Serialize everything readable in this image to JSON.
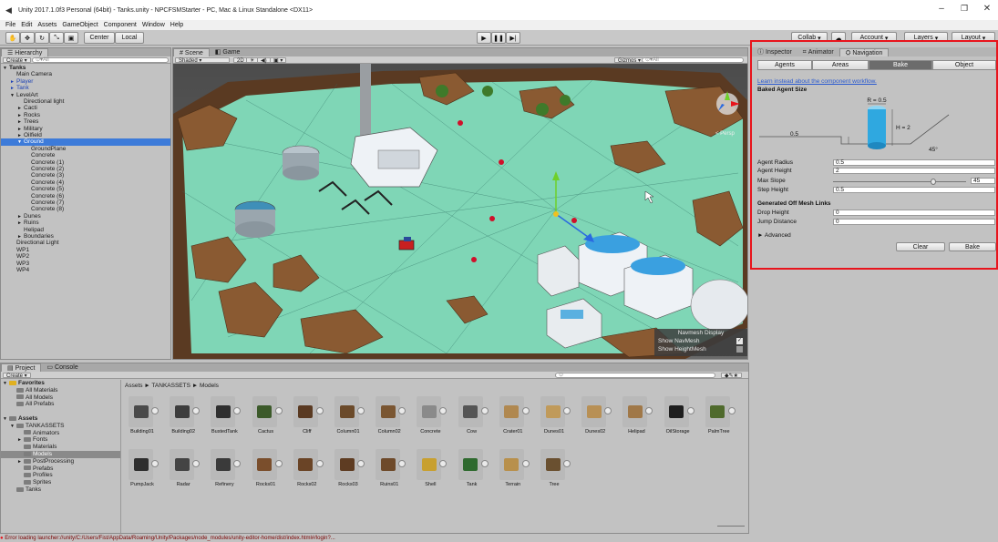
{
  "window": {
    "title": "Unity 2017.1.0f3 Personal (64bit) - Tanks.unity - NPCFSMStarter - PC, Mac & Linux Standalone <DX11>"
  },
  "menu": [
    "File",
    "Edit",
    "Assets",
    "GameObject",
    "Component",
    "Window",
    "Help"
  ],
  "toolbar": {
    "pivot": "Center",
    "space": "Local",
    "collab": "Collab",
    "account": "Account",
    "layers": "Layers",
    "layout": "Layout"
  },
  "hierarchy": {
    "tab": "Hierarchy",
    "create": "Create",
    "search": "All",
    "rows": [
      {
        "text": "Tanks",
        "indent": 0,
        "style": "bold",
        "arrow": "▼"
      },
      {
        "text": "Main Camera",
        "indent": 1,
        "style": "",
        "arrow": ""
      },
      {
        "text": "Player",
        "indent": 1,
        "style": "blue",
        "arrow": "►"
      },
      {
        "text": "Tank",
        "indent": 1,
        "style": "blue",
        "arrow": "►"
      },
      {
        "text": "LevelArt",
        "indent": 1,
        "style": "",
        "arrow": "▼"
      },
      {
        "text": "Directional light",
        "indent": 2,
        "style": "",
        "arrow": ""
      },
      {
        "text": "Cacti",
        "indent": 2,
        "style": "",
        "arrow": "►"
      },
      {
        "text": "Rocks",
        "indent": 2,
        "style": "",
        "arrow": "►"
      },
      {
        "text": "Trees",
        "indent": 2,
        "style": "",
        "arrow": "►"
      },
      {
        "text": "Military",
        "indent": 2,
        "style": "",
        "arrow": "►"
      },
      {
        "text": "Oilfield",
        "indent": 2,
        "style": "",
        "arrow": "►"
      },
      {
        "text": "Ground",
        "indent": 2,
        "style": "sel",
        "arrow": "▼"
      },
      {
        "text": "GroundPlane",
        "indent": 3,
        "style": "",
        "arrow": ""
      },
      {
        "text": "Concrete",
        "indent": 3,
        "style": "",
        "arrow": ""
      },
      {
        "text": "Concrete (1)",
        "indent": 3,
        "style": "",
        "arrow": ""
      },
      {
        "text": "Concrete (2)",
        "indent": 3,
        "style": "",
        "arrow": ""
      },
      {
        "text": "Concrete (3)",
        "indent": 3,
        "style": "",
        "arrow": ""
      },
      {
        "text": "Concrete (4)",
        "indent": 3,
        "style": "",
        "arrow": ""
      },
      {
        "text": "Concrete (5)",
        "indent": 3,
        "style": "",
        "arrow": ""
      },
      {
        "text": "Concrete (6)",
        "indent": 3,
        "style": "",
        "arrow": ""
      },
      {
        "text": "Concrete (7)",
        "indent": 3,
        "style": "",
        "arrow": ""
      },
      {
        "text": "Concrete (8)",
        "indent": 3,
        "style": "",
        "arrow": ""
      },
      {
        "text": "Dunes",
        "indent": 2,
        "style": "",
        "arrow": "►"
      },
      {
        "text": "Ruins",
        "indent": 2,
        "style": "",
        "arrow": "►"
      },
      {
        "text": "Helipad",
        "indent": 2,
        "style": "",
        "arrow": ""
      },
      {
        "text": "Boundaries",
        "indent": 2,
        "style": "",
        "arrow": "►"
      },
      {
        "text": "Directional Light",
        "indent": 1,
        "style": "",
        "arrow": ""
      },
      {
        "text": "WP1",
        "indent": 1,
        "style": "",
        "arrow": ""
      },
      {
        "text": "WP2",
        "indent": 1,
        "style": "",
        "arrow": ""
      },
      {
        "text": "WP3",
        "indent": 1,
        "style": "",
        "arrow": ""
      },
      {
        "text": "WP4",
        "indent": 1,
        "style": "",
        "arrow": ""
      }
    ]
  },
  "scene": {
    "tab_scene": "Scene",
    "tab_game": "Game",
    "shading": "Shaded",
    "mode_2d": "2D",
    "gizmos": "Gizmos",
    "search": "All",
    "persp": "< Persp",
    "navmesh_display": {
      "title": "Navmesh Display",
      "show_navmesh": "Show NavMesh",
      "show_heightmesh": "Show HeightMesh",
      "navmesh_checked": true,
      "heightmesh_checked": false
    }
  },
  "inspector": {
    "tabs": [
      "Inspector",
      "Animator",
      "Navigation"
    ],
    "active_tab": "Navigation",
    "nav_tabs": [
      "Agents",
      "Areas",
      "Bake",
      "Object"
    ],
    "active_nav_tab": "Bake",
    "link": "Learn instead about the component workflow.",
    "baked_title": "Baked Agent Size",
    "diagram": {
      "r": "R = 0.5",
      "h": "H = 2",
      "step": "0.5",
      "angle": "45°"
    },
    "fields": [
      {
        "label": "Agent Radius",
        "value": "0.5"
      },
      {
        "label": "Agent Height",
        "value": "2"
      },
      {
        "label": "Max Slope",
        "value": "45"
      },
      {
        "label": "Step Height",
        "value": "0.5"
      }
    ],
    "max_slope_fraction": 0.75,
    "offmesh_title": "Generated Off Mesh Links",
    "offmesh_fields": [
      {
        "label": "Drop Height",
        "value": "0"
      },
      {
        "label": "Jump Distance",
        "value": "0"
      }
    ],
    "advanced": "Advanced",
    "clear": "Clear",
    "bake": "Bake"
  },
  "project": {
    "tab_project": "Project",
    "tab_console": "Console",
    "create": "Create",
    "breadcrumb": "Assets ► TANKASSETS ► Models",
    "tree": [
      {
        "text": "Favorites",
        "indent": 0,
        "style": "bold",
        "arrow": "▼"
      },
      {
        "text": "All Materials",
        "indent": 1,
        "style": "",
        "arrow": ""
      },
      {
        "text": "All Models",
        "indent": 1,
        "style": "",
        "arrow": ""
      },
      {
        "text": "All Prefabs",
        "indent": 1,
        "style": "",
        "arrow": ""
      },
      {
        "text": "",
        "indent": 0,
        "style": "",
        "arrow": ""
      },
      {
        "text": "Assets",
        "indent": 0,
        "style": "bold",
        "arrow": "▼"
      },
      {
        "text": "TANKASSETS",
        "indent": 1,
        "style": "",
        "arrow": "▼"
      },
      {
        "text": "Animators",
        "indent": 2,
        "style": "",
        "arrow": ""
      },
      {
        "text": "Fonts",
        "indent": 2,
        "style": "",
        "arrow": "►"
      },
      {
        "text": "Materials",
        "indent": 2,
        "style": "",
        "arrow": ""
      },
      {
        "text": "Models",
        "indent": 2,
        "style": "sel",
        "arrow": ""
      },
      {
        "text": "PostProcessing",
        "indent": 2,
        "style": "",
        "arrow": "►"
      },
      {
        "text": "Prefabs",
        "indent": 2,
        "style": "",
        "arrow": ""
      },
      {
        "text": "Profiles",
        "indent": 2,
        "style": "",
        "arrow": ""
      },
      {
        "text": "Sprites",
        "indent": 2,
        "style": "",
        "arrow": ""
      },
      {
        "text": "Tanks",
        "indent": 1,
        "style": "",
        "arrow": ""
      }
    ],
    "assets": [
      {
        "name": "Building01",
        "color": "#4a4a4a"
      },
      {
        "name": "Building02",
        "color": "#3d3d3d"
      },
      {
        "name": "BustedTank",
        "color": "#2f2f2f"
      },
      {
        "name": "Cactus",
        "color": "#3c5a2a"
      },
      {
        "name": "Cliff",
        "color": "#5a3a22"
      },
      {
        "name": "Column01",
        "color": "#6b4a2a"
      },
      {
        "name": "Column02",
        "color": "#7a5632"
      },
      {
        "name": "Concrete",
        "color": "#8a8a8a"
      },
      {
        "name": "Cow",
        "color": "#555555"
      },
      {
        "name": "Crater01",
        "color": "#b08850"
      },
      {
        "name": "Dunes01",
        "color": "#c09a5a"
      },
      {
        "name": "Dunes02",
        "color": "#b89055"
      },
      {
        "name": "Helipad",
        "color": "#a07848"
      },
      {
        "name": "OilStorage",
        "color": "#1e1e1e"
      },
      {
        "name": "PalmTree",
        "color": "#4f6a2c"
      },
      {
        "name": "PumpJack",
        "color": "#2e2e2e"
      },
      {
        "name": "Radar",
        "color": "#444444"
      },
      {
        "name": "Refinery",
        "color": "#3a3a3a"
      },
      {
        "name": "Rocks01",
        "color": "#7a4e2c"
      },
      {
        "name": "Rocks02",
        "color": "#6a4426"
      },
      {
        "name": "Rocks03",
        "color": "#5e3c22"
      },
      {
        "name": "Ruins01",
        "color": "#6e4a2a"
      },
      {
        "name": "Shell",
        "color": "#c8a030"
      },
      {
        "name": "Tank",
        "color": "#2f6a2f"
      },
      {
        "name": "Terrain",
        "color": "#b8904c"
      },
      {
        "name": "Tree",
        "color": "#6a5030"
      }
    ]
  },
  "status": {
    "error": "Error loading launcher://unity/C:/Users/Fist/AppData/Roaming/Unity/Packages/node_modules/unity-editor-home/dist/index.html#/login?..."
  },
  "colors": {
    "accent_red": "#e8141c",
    "selection": "#3d7bd9",
    "navmesh": "#7fd6b6",
    "cylinder": "#2fa8e0"
  }
}
